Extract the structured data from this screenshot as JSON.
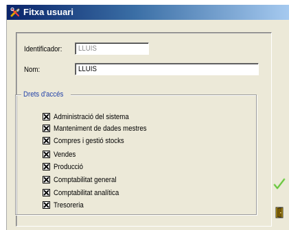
{
  "window": {
    "title": "Fitxa usuari"
  },
  "form": {
    "identificador_label": "Identificador:",
    "identificador_value": "LLUIS",
    "nom_label": "Nom:",
    "nom_value": "LLUIS"
  },
  "permissions": {
    "group_title": "Drets d'accés",
    "items": [
      {
        "label": "Administració del sistema",
        "checked": true
      },
      {
        "label": "Manteniment de dades mestres",
        "checked": true
      },
      {
        "label": "Compres i gestió stocks",
        "checked": true
      },
      {
        "label": "Vendes",
        "checked": true
      },
      {
        "label": "Producció",
        "checked": true
      },
      {
        "label": "Comptabilitat general",
        "checked": true
      },
      {
        "label": "Comptabilitat analítica",
        "checked": true
      },
      {
        "label": "Tresoreria",
        "checked": true
      }
    ]
  },
  "actions": {
    "ok_icon": "checkmark-icon",
    "exit_icon": "door-exit-icon"
  },
  "colors": {
    "title_bar_start": "#0a246a",
    "title_bar_end": "#a6caf0",
    "window_background": "#ece9d8",
    "group_title": "#1f3fa8",
    "ok_check": "#7fd14a"
  }
}
